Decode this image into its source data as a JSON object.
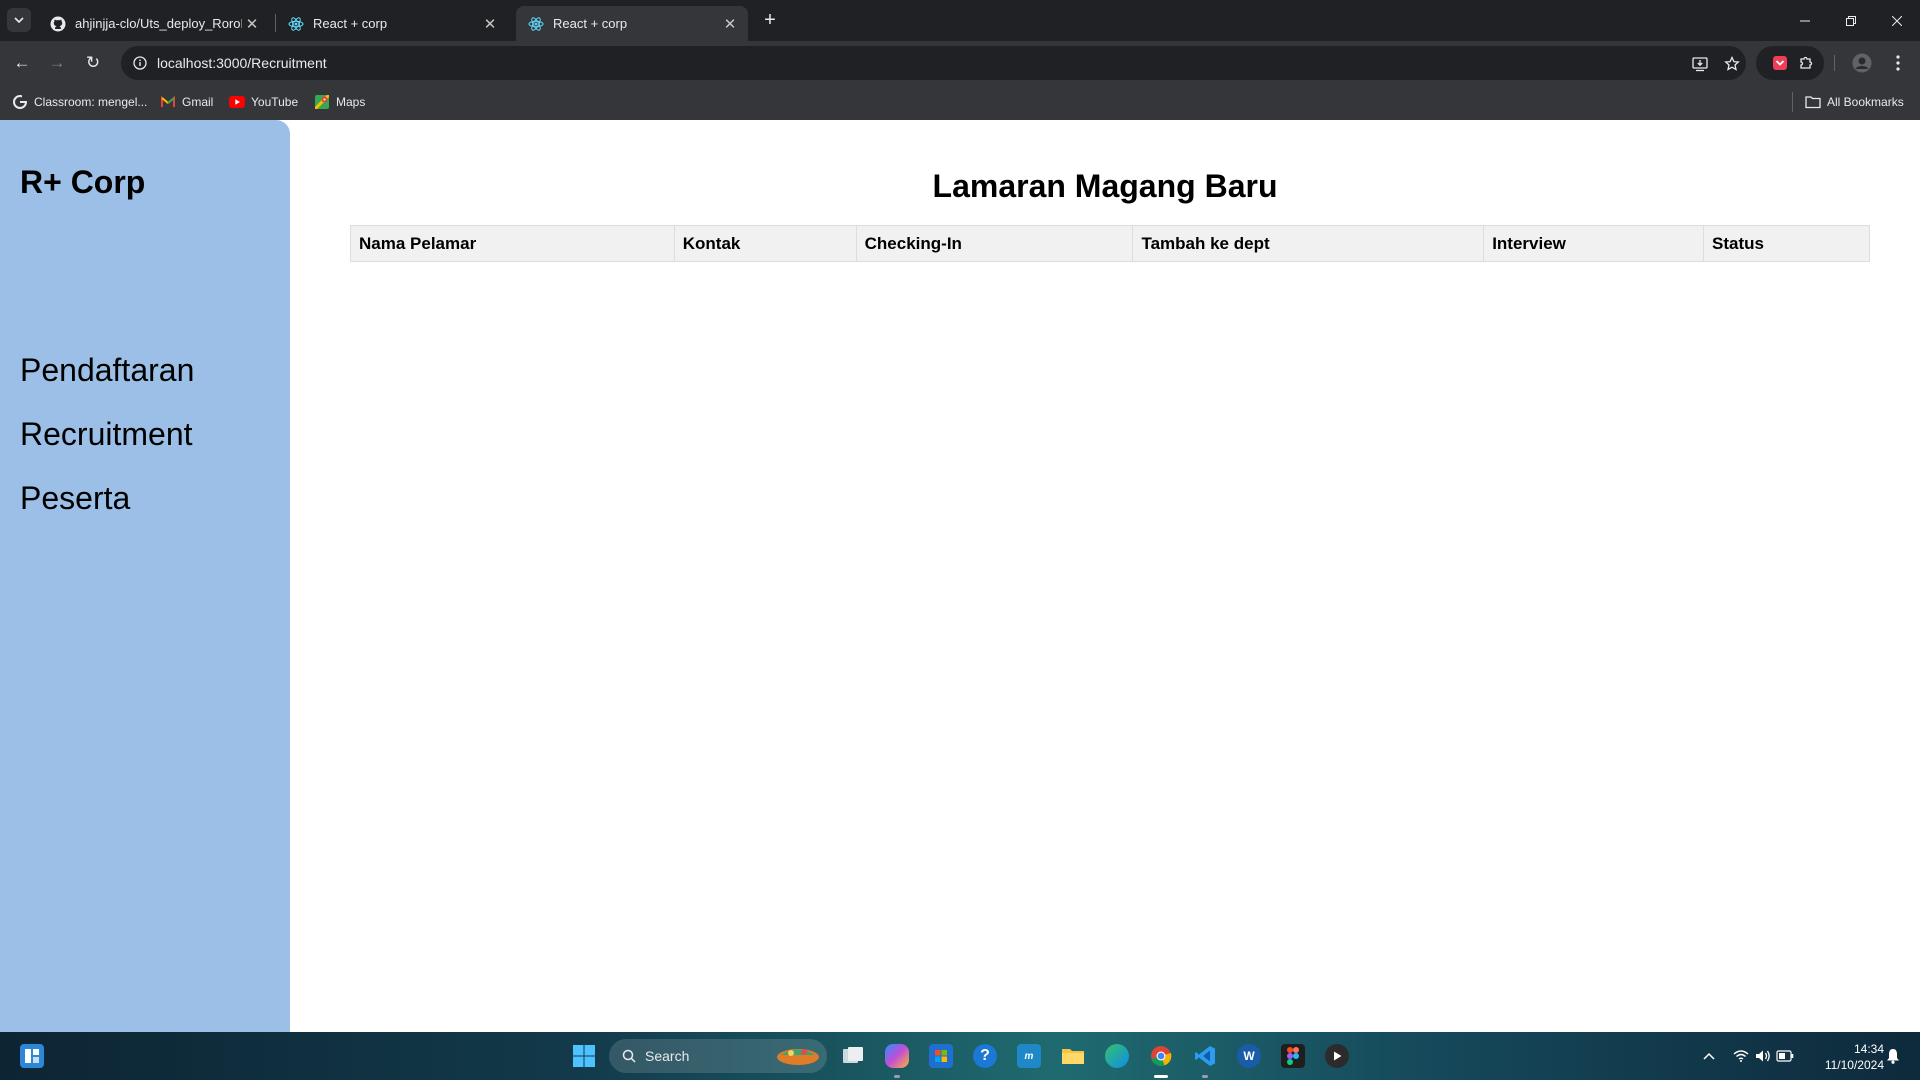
{
  "browser": {
    "tabs": [
      {
        "title": "ahjinjja-clo/Uts_deploy_RoroPr",
        "favicon": "github-icon"
      },
      {
        "title": "React + corp",
        "favicon": "react-icon"
      },
      {
        "title": "React + corp",
        "favicon": "react-icon",
        "active": true
      }
    ],
    "url": "localhost:3000/Recruitment",
    "bookmarks": [
      {
        "label": "Classroom: mengel...",
        "icon": "google-icon"
      },
      {
        "label": "Gmail",
        "icon": "gmail-icon"
      },
      {
        "label": "YouTube",
        "icon": "youtube-icon"
      },
      {
        "label": "Maps",
        "icon": "maps-icon"
      }
    ],
    "all_bookmarks": "All Bookmarks"
  },
  "sidebar": {
    "brand": "R+ Corp",
    "items": [
      {
        "label": "Pendaftaran"
      },
      {
        "label": "Recruitment"
      },
      {
        "label": "Peserta"
      }
    ],
    "bg_color": "#9bbfe6"
  },
  "main": {
    "title": "Lamaran Magang Baru",
    "table": {
      "columns": [
        "Nama Pelamar",
        "Kontak",
        "Checking-In",
        "Tambah ke dept",
        "Interview",
        "Status"
      ],
      "rows": []
    }
  },
  "taskbar": {
    "search_placeholder": "Search",
    "time": "14:34",
    "date": "11/10/2024"
  }
}
